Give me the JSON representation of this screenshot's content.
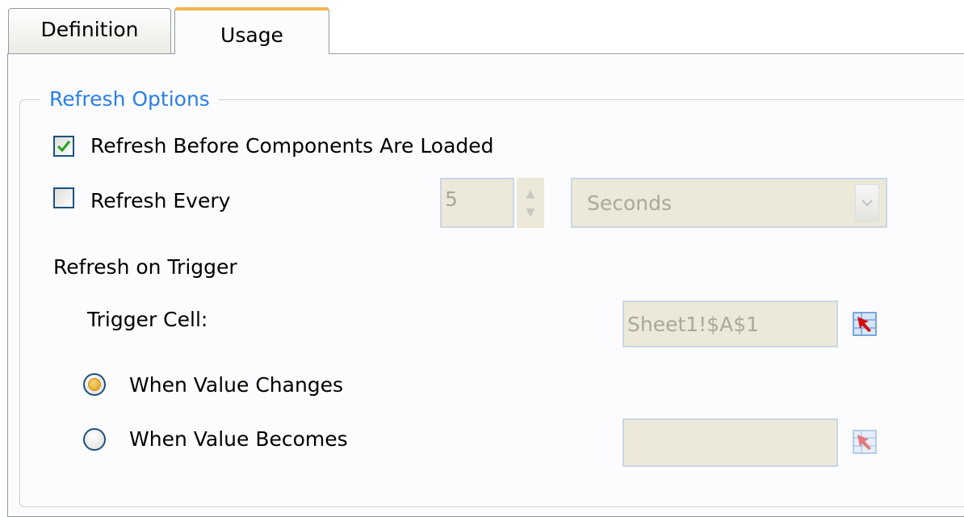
{
  "tabs": [
    {
      "label": "Definition",
      "selected": false
    },
    {
      "label": "Usage",
      "selected": true
    }
  ],
  "group": {
    "legend": "Refresh Options"
  },
  "refresh_before": {
    "label": "Refresh Before Components Are Loaded",
    "checked": true
  },
  "refresh_every": {
    "label": "Refresh Every",
    "checked": false,
    "interval_value": "5",
    "unit_value": "Seconds"
  },
  "trigger": {
    "heading": "Refresh on Trigger",
    "cell_label": "Trigger Cell:",
    "cell_value": "Sheet1!$A$1",
    "when_changes_label": "When Value Changes",
    "when_changes_selected": true,
    "when_becomes_label": "When Value Becomes",
    "when_becomes_selected": false,
    "when_becomes_value": ""
  },
  "colors": {
    "accent": "#f5b44c",
    "legend": "#2a7fe8",
    "check": "#21a121"
  },
  "icons": [
    "checkmark-icon",
    "spin-up-icon",
    "spin-down-icon",
    "dropdown-arrow-icon",
    "cell-picker-icon"
  ]
}
